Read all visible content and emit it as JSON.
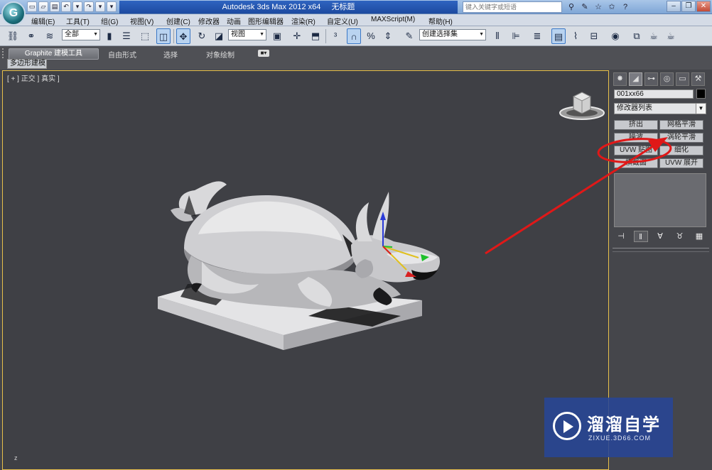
{
  "titlebar": {
    "title": "Autodesk 3ds Max  2012 x64",
    "document": "无标题",
    "search_placeholder": "键入关键字或短语",
    "app_icon": "3ds-max-logo",
    "tools_icons": [
      "binoculars-icon",
      "wrench-icon",
      "star-icon",
      "star-icon",
      "help-icon"
    ],
    "window_controls": [
      "minimize-icon",
      "restore-icon",
      "close-icon"
    ]
  },
  "menubar": {
    "items": [
      "编辑(E)",
      "工具(T)",
      "组(G)",
      "视图(V)",
      "创建(C)",
      "修改器",
      "动画",
      "图形编辑器",
      "渲染(R)",
      "自定义(U)",
      "MAXScript(M)",
      "帮助(H)"
    ]
  },
  "toolbar": {
    "selection_filter": "全部",
    "reference_coord": "视图",
    "named_selection": "创建选择集"
  },
  "ribbon": {
    "tabs": [
      "Graphite 建模工具",
      "自由形式",
      "选择",
      "对象绘制"
    ],
    "panel_label": "多边形建模"
  },
  "viewport": {
    "label": "[ + ] 正交 ] 真实 ]",
    "axis_label": "z"
  },
  "command_panel": {
    "object_name": "001xx66",
    "modifier_list": "修改器列表",
    "modifier_buttons": [
      "挤出",
      "网格平滑",
      "噪波",
      "涡轮平滑",
      "UVW 贴图",
      "细化",
      "横截面",
      "UVW 展开"
    ],
    "highlighted_button": "UVW 贴图"
  },
  "annotation": {
    "color": "#e01818"
  },
  "watermark": {
    "title": "溜溜自学",
    "url": "ZIXUE.3D66.COM"
  }
}
